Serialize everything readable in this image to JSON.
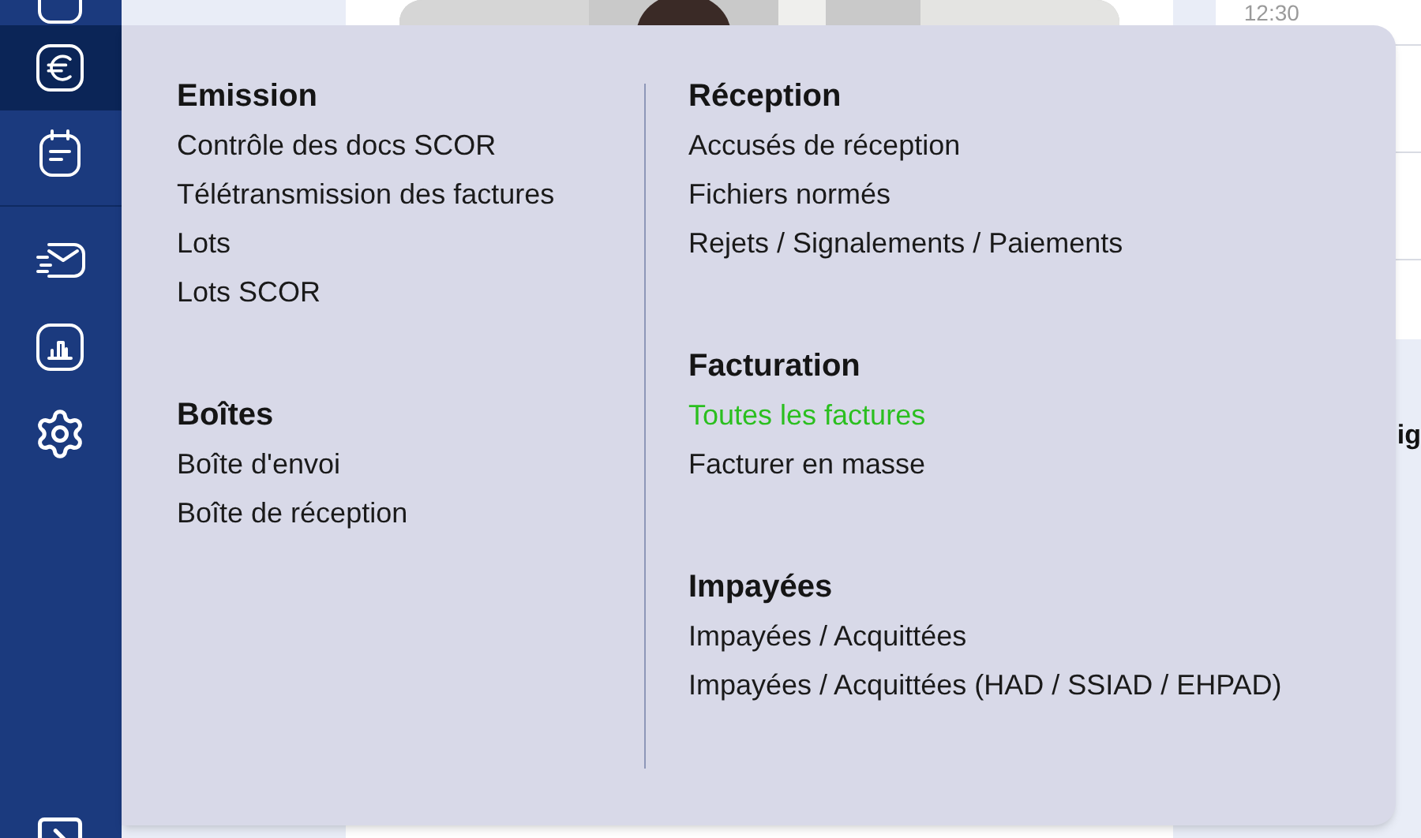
{
  "sidebar": {
    "items": [
      {
        "selected": false
      },
      {
        "selected": true
      },
      {
        "selected": false
      },
      {
        "selected": false
      },
      {
        "selected": false
      },
      {
        "selected": false
      }
    ]
  },
  "background": {
    "time": "12:30",
    "heading_fragment": "ig"
  },
  "menu": {
    "columns": [
      {
        "sections": [
          {
            "title": "Emission",
            "items": [
              {
                "label": "Contrôle des docs SCOR",
                "selected": false
              },
              {
                "label": "Télétransmission des factures",
                "selected": false
              },
              {
                "label": "Lots",
                "selected": false
              },
              {
                "label": "Lots SCOR",
                "selected": false
              }
            ]
          },
          {
            "title": "Boîtes",
            "items": [
              {
                "label": "Boîte d'envoi",
                "selected": false
              },
              {
                "label": "Boîte de réception",
                "selected": false
              }
            ]
          }
        ]
      },
      {
        "sections": [
          {
            "title": "Réception",
            "items": [
              {
                "label": "Accusés de réception",
                "selected": false
              },
              {
                "label": "Fichiers normés",
                "selected": false
              },
              {
                "label": "Rejets / Signalements / Paiements",
                "selected": false
              }
            ]
          },
          {
            "title": "Facturation",
            "items": [
              {
                "label": "Toutes les factures",
                "selected": true
              },
              {
                "label": "Facturer en masse",
                "selected": false
              }
            ]
          },
          {
            "title": "Impayées",
            "items": [
              {
                "label": "Impayées / Acquittées",
                "selected": false
              },
              {
                "label": "Impayées / Acquittées (HAD / SSIAD / EHPAD)",
                "selected": false
              }
            ]
          }
        ]
      }
    ]
  }
}
